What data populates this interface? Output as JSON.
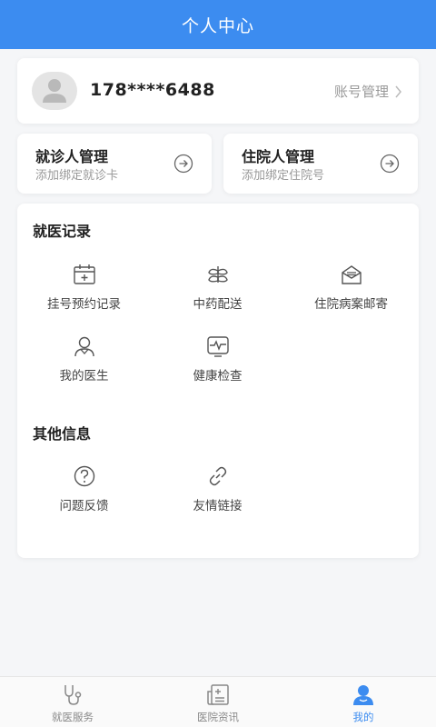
{
  "header": {
    "title": "个人中心"
  },
  "user": {
    "phone": "178****6488",
    "account_label": "账号管理"
  },
  "patient_cards": [
    {
      "title": "就诊人管理",
      "subtitle": "添加绑定就诊卡"
    },
    {
      "title": "住院人管理",
      "subtitle": "添加绑定住院号"
    }
  ],
  "records": {
    "title": "就医记录",
    "items": [
      {
        "label": "挂号预约记录",
        "icon": "calendar-icon"
      },
      {
        "label": "中药配送",
        "icon": "herb-icon"
      },
      {
        "label": "住院病案邮寄",
        "icon": "mail-icon"
      },
      {
        "label": "我的医生",
        "icon": "doctor-icon"
      },
      {
        "label": "健康检查",
        "icon": "pulse-icon"
      }
    ]
  },
  "other": {
    "title": "其他信息",
    "items": [
      {
        "label": "问题反馈",
        "icon": "question-icon"
      },
      {
        "label": "友情链接",
        "icon": "link-icon"
      }
    ]
  },
  "tabbar": {
    "tabs": [
      {
        "label": "就医服务",
        "icon": "stethoscope-icon"
      },
      {
        "label": "医院资讯",
        "icon": "news-icon"
      },
      {
        "label": "我的",
        "icon": "user-icon"
      }
    ],
    "active_index": 2
  },
  "colors": {
    "primary": "#3c8cf0",
    "text": "#333333",
    "muted": "#999999",
    "background": "#f5f6f8"
  }
}
